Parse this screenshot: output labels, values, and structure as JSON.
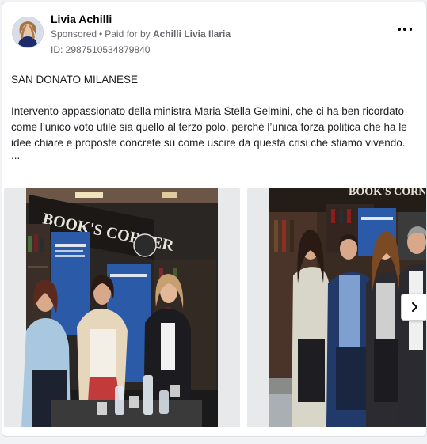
{
  "post": {
    "author_name": "Livia Achilli",
    "sponsored_label": "Sponsored",
    "separator": "•",
    "paid_for_prefix": "Paid for by",
    "paid_for_name": "Achilli Livia Ilaria",
    "ad_id": "ID: 2987510534879840",
    "location": "SAN DONATO MILANESE",
    "body": "Intervento appassionato della ministra Maria Stella Gelmini, che ci ha ben ricordato come l’unico voto utile sia quello al terzo polo, perché l’unica forza politica che ha le idee chiare e proposte concrete su come uscire da questa crisi che stiamo vivendo.",
    "ellipsis": "..."
  },
  "carousel": {
    "photo1": {
      "sign_text": "BOOK'S CORNER"
    },
    "photo2": {
      "sign_text": "BOOK'S CORNER"
    }
  },
  "icons": {
    "more": "more-options-icon",
    "next": "chevron-right-icon"
  },
  "colors": {
    "text_primary": "#050505",
    "text_secondary": "#65676b",
    "border": "#dddfe2",
    "background": "#f0f2f5",
    "poster_blue": "#2b5aa8"
  }
}
